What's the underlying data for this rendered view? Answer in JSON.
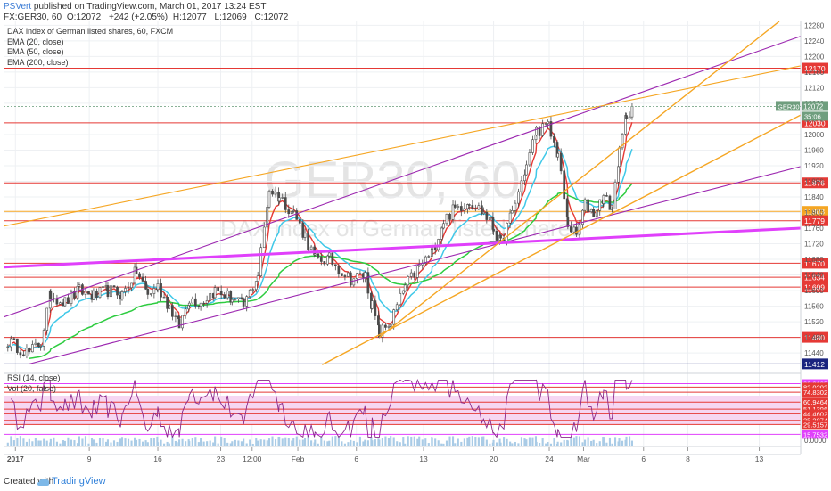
{
  "header": {
    "author": "PSVert",
    "published": "published on TradingView.com, March 01, 2017 13:24 EST",
    "symbol": "FX:GER30, 60",
    "ohlc": {
      "O": "12072",
      "change": "+242 (+2.05%)",
      "H": "12077",
      "L": "12069",
      "C": "12072"
    }
  },
  "legend": {
    "title": "DAX index of German listed shares, 60, FXCM",
    "items": [
      "EMA (20, close)",
      "EMA (50, close)",
      "EMA (200, close)"
    ]
  },
  "watermark": {
    "line1": "GER30, 60",
    "line2": "DAX index of German listed shares"
  },
  "footer": {
    "created": "Created with",
    "brand": "TradingView"
  },
  "colors": {
    "red": "#e53935",
    "purple": "#9c27b0",
    "magenta": "#e040fb",
    "orange": "#f5a623",
    "navy": "#1a237e",
    "ema_red": "#e53935",
    "ema_cyan": "#3fc8e8",
    "ema_green": "#2ecc40",
    "candle": "#4a4a4a",
    "rsi_line": "#8a2a8a",
    "rsi_band": "#f6d7f2"
  },
  "chart_data": [
    {
      "type": "candlestick",
      "name": "price",
      "ylim": [
        11390,
        12290
      ],
      "y_ticks": [
        11440,
        11480,
        11520,
        11560,
        11600,
        11640,
        11680,
        11720,
        11760,
        11800,
        11840,
        11880,
        11920,
        11960,
        12000,
        12040,
        12080,
        12120,
        12160,
        12200,
        12240,
        12280
      ],
      "x_ticks": [
        "2017",
        "9",
        "16",
        "23",
        "12:00",
        "Feb",
        "6",
        "13",
        "20",
        "24",
        "Mar",
        "6",
        "8",
        "13"
      ],
      "x_tick_positions": [
        0.03,
        5.2,
        10.0,
        14.4,
        16.6,
        19.8,
        23.9,
        28.6,
        33.5,
        37.4,
        39.8,
        44.0,
        47.1,
        52.1
      ],
      "x_range": [
        -0.8,
        55
      ],
      "horizontal_levels": [
        {
          "value": 12170,
          "label": "12170"
        },
        {
          "value": 12030,
          "label": "12030"
        },
        {
          "value": 11876,
          "label": "11876"
        },
        {
          "value": 11803,
          "label": "11803"
        },
        {
          "value": 11779,
          "label": "11779"
        },
        {
          "value": 11670,
          "label": "11670"
        },
        {
          "value": 11634,
          "label": "11634"
        },
        {
          "value": 11609,
          "label": "11609"
        },
        {
          "value": 11480,
          "label": "11480"
        },
        {
          "value": 11412,
          "label": "11412"
        }
      ],
      "last_price": {
        "label": "GER30",
        "value": "12072",
        "countdown": "35:06"
      },
      "trend_lines": [
        {
          "color": "purple",
          "x1": -0.8,
          "y1": 11532,
          "x2": 55,
          "y2": 12252
        },
        {
          "color": "purple",
          "x1": 1.0,
          "y1": 11412,
          "x2": 55,
          "y2": 11918
        },
        {
          "color": "magenta",
          "x1": -0.8,
          "y1": 11660,
          "x2": 55,
          "y2": 11760
        },
        {
          "color": "orange",
          "x1": 25.5,
          "y1": 11480,
          "x2": 53.5,
          "y2": 12290
        },
        {
          "color": "orange",
          "x1": -0.8,
          "y1": 11765,
          "x2": 55,
          "y2": 12176
        },
        {
          "color": "orange",
          "x1": 21.5,
          "y1": 11410,
          "x2": 55,
          "y2": 12050
        }
      ],
      "anchors": [
        [
          -0.5,
          11470
        ],
        [
          1.0,
          11440
        ],
        [
          1.8,
          11468
        ],
        [
          2.5,
          11590
        ],
        [
          3.5,
          11570
        ],
        [
          4.5,
          11600
        ],
        [
          5.5,
          11585
        ],
        [
          6.5,
          11600
        ],
        [
          7.5,
          11590
        ],
        [
          8.5,
          11650
        ],
        [
          9.3,
          11590
        ],
        [
          10.0,
          11610
        ],
        [
          10.8,
          11560
        ],
        [
          11.5,
          11510
        ],
        [
          12.2,
          11580
        ],
        [
          13.0,
          11570
        ],
        [
          14.0,
          11600
        ],
        [
          15.2,
          11580
        ],
        [
          16.0,
          11560
        ],
        [
          17.0,
          11640
        ],
        [
          17.8,
          11860
        ],
        [
          18.5,
          11840
        ],
        [
          19.5,
          11800
        ],
        [
          20.3,
          11740
        ],
        [
          21.0,
          11680
        ],
        [
          22.0,
          11680
        ],
        [
          23.5,
          11630
        ],
        [
          24.5,
          11640
        ],
        [
          25.0,
          11560
        ],
        [
          25.5,
          11490
        ],
        [
          26.3,
          11520
        ],
        [
          27.3,
          11610
        ],
        [
          28.3,
          11660
        ],
        [
          29.2,
          11700
        ],
        [
          30.0,
          11780
        ],
        [
          30.8,
          11810
        ],
        [
          31.8,
          11830
        ],
        [
          32.8,
          11800
        ],
        [
          33.5,
          11760
        ],
        [
          34.0,
          11720
        ],
        [
          34.8,
          11800
        ],
        [
          35.8,
          11920
        ],
        [
          36.5,
          12010
        ],
        [
          37.3,
          12020
        ],
        [
          38.0,
          11950
        ],
        [
          38.7,
          11770
        ],
        [
          39.3,
          11740
        ],
        [
          39.9,
          11820
        ],
        [
          40.5,
          11800
        ],
        [
          41.2,
          11840
        ],
        [
          41.8,
          11810
        ],
        [
          42.3,
          11950
        ],
        [
          42.8,
          12050
        ],
        [
          43.2,
          12072
        ]
      ],
      "ema": [
        {
          "name": "EMA (20, close)",
          "color": "ema_red",
          "period": 20
        },
        {
          "name": "EMA (50, close)",
          "color": "ema_cyan",
          "period": 50
        },
        {
          "name": "EMA (200, close)",
          "color": "ema_green",
          "period": 200
        }
      ]
    },
    {
      "type": "line",
      "name": "RSI (14, close)",
      "label": "RSI (14, close)",
      "ylim": [
        0,
        100
      ],
      "levels": [
        {
          "value": 86.8135,
          "label": "86.8135",
          "color": "#e040fb"
        },
        {
          "value": 82.0202,
          "label": "82.0202",
          "color": "#e53935"
        },
        {
          "value": 74.8302,
          "label": "74.8302",
          "color": "#e53935"
        },
        {
          "value": 60.9464,
          "label": "60.9464",
          "color": "#e53935"
        },
        {
          "value": 51.1396,
          "label": "51.1396",
          "color": "#e53935"
        },
        {
          "value": 44.4602,
          "label": "44.4602",
          "color": "#e53935"
        },
        {
          "value": 35.3874,
          "label": "35.3874",
          "color": "#e53935"
        },
        {
          "value": 29.5157,
          "label": "29.5157",
          "color": "#e53935"
        },
        {
          "value": 15.7532,
          "label": "15.7532",
          "color": "#e040fb"
        }
      ],
      "band": [
        30,
        70
      ]
    },
    {
      "type": "bar",
      "name": "Vol (20, false)",
      "label": "Vol (20, false)",
      "axis_label": "0.0000"
    }
  ]
}
